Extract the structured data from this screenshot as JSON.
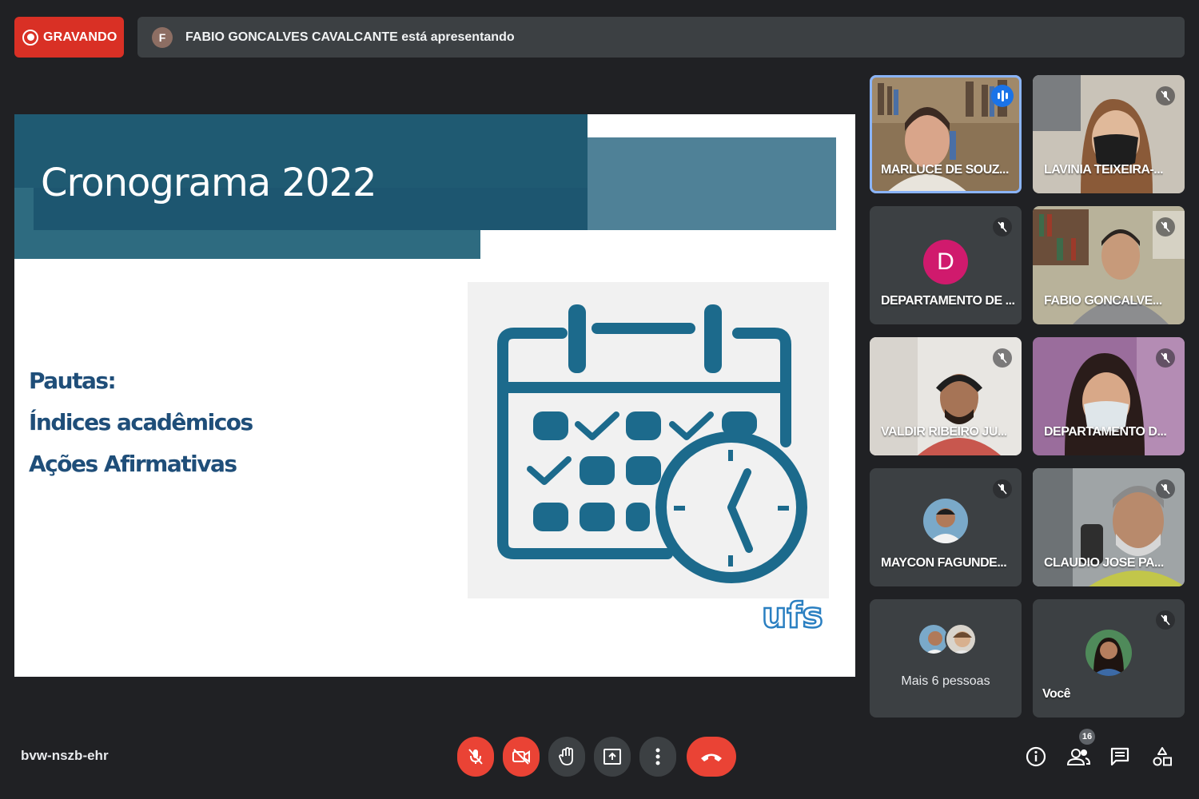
{
  "recording": {
    "label": "GRAVANDO"
  },
  "presenter": {
    "initial": "F",
    "text": "FABIO GONCALVES CAVALCANTE está apresentando"
  },
  "slide": {
    "title": "Cronograma 2022",
    "pautas": [
      "Pautas:",
      "Índices acadêmicos",
      "Ações Afirmativas"
    ],
    "logo_text": "ufs"
  },
  "participants": [
    {
      "name": "MARLUCE DE SOUZ...",
      "state": "speaking"
    },
    {
      "name": "LAVINIA TEIXEIRA-...",
      "state": "muted"
    },
    {
      "name": "DEPARTAMENTO DE ...",
      "state": "muted",
      "initial": "D"
    },
    {
      "name": "FABIO GONCALVE...",
      "state": "muted"
    },
    {
      "name": "VALDIR RIBEIRO JU...",
      "state": "muted"
    },
    {
      "name": "DEPARTAMENTO D...",
      "state": "muted"
    },
    {
      "name": "MAYCON FAGUNDE...",
      "state": "muted"
    },
    {
      "name": "CLAUDIO JOSE PA...",
      "state": "muted"
    }
  ],
  "more": {
    "label": "Mais 6 pessoas"
  },
  "self": {
    "label": "Você"
  },
  "meeting": {
    "code": "bvw-nszb-ehr",
    "participant_count": "16"
  },
  "colors": {
    "accent": "#8ab4f8",
    "danger": "#ea4335",
    "recording": "#d93025",
    "slide_blue": "#1f5a72"
  }
}
